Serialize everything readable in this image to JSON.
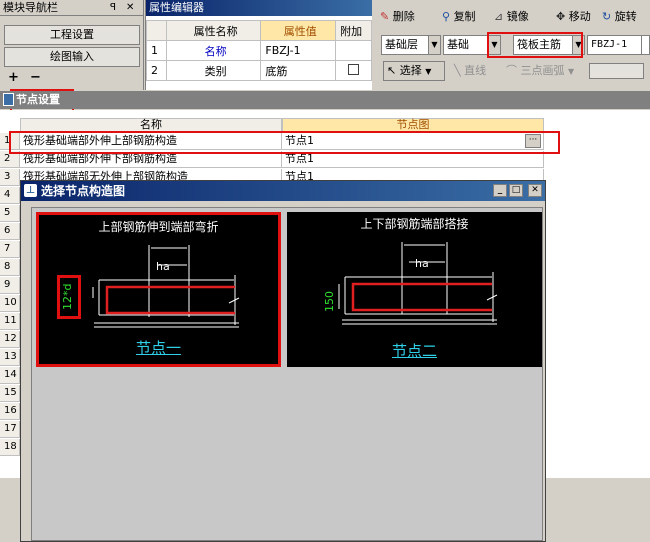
{
  "nav": {
    "title": "模块导航栏",
    "pin": "ꟼ",
    "close": "✕",
    "buttons": [
      "工程设置",
      "绘图输入"
    ],
    "plus": "+",
    "minus": "−"
  },
  "prop_editor": {
    "title": "属性编辑器",
    "headers": [
      "属性名称",
      "属性值",
      "附加"
    ],
    "rows": [
      {
        "num": "1",
        "name": "名称",
        "value": "FBZJ-1"
      },
      {
        "num": "2",
        "name": "类别",
        "value": "底筋"
      }
    ]
  },
  "toolbar": {
    "delete": "删除",
    "copy": "复制",
    "mirror": "镜像",
    "move": "移动",
    "rotate": "旋转",
    "layer": "基础层",
    "type": "基础",
    "element": "筏板主筋",
    "name": "FBZJ-1",
    "select": "选择",
    "line": "直线",
    "arc": "三点画弧"
  },
  "node_settings": {
    "title": "节点设置",
    "col_name": "名称",
    "col_node": "节点图",
    "rows": [
      {
        "num": "1",
        "name": "筏形基础端部外伸上部钢筋构造",
        "node": "节点1",
        "has_btn": true
      },
      {
        "num": "2",
        "name": "筏形基础端部外伸下部钢筋构造",
        "node": "节点1"
      },
      {
        "num": "3",
        "name": "筏形基础端部无外伸上部钢筋构造",
        "node": "节点1"
      }
    ],
    "more_rows": [
      "4",
      "5",
      "6",
      "7",
      "8",
      "9",
      "10",
      "11",
      "12",
      "13",
      "14",
      "15",
      "16",
      "17",
      "18"
    ]
  },
  "dialog": {
    "title": "选择节点构造图",
    "min": "_",
    "max": "□",
    "close": "✕",
    "options": [
      {
        "caption": "上部钢筋伸到端部弯折",
        "node_label": "节点一",
        "dim": "12*d",
        "ha": "ha"
      },
      {
        "caption": "上下部钢筋端部搭接",
        "node_label": "节点二",
        "dim": "150",
        "ha": "ha"
      }
    ]
  }
}
